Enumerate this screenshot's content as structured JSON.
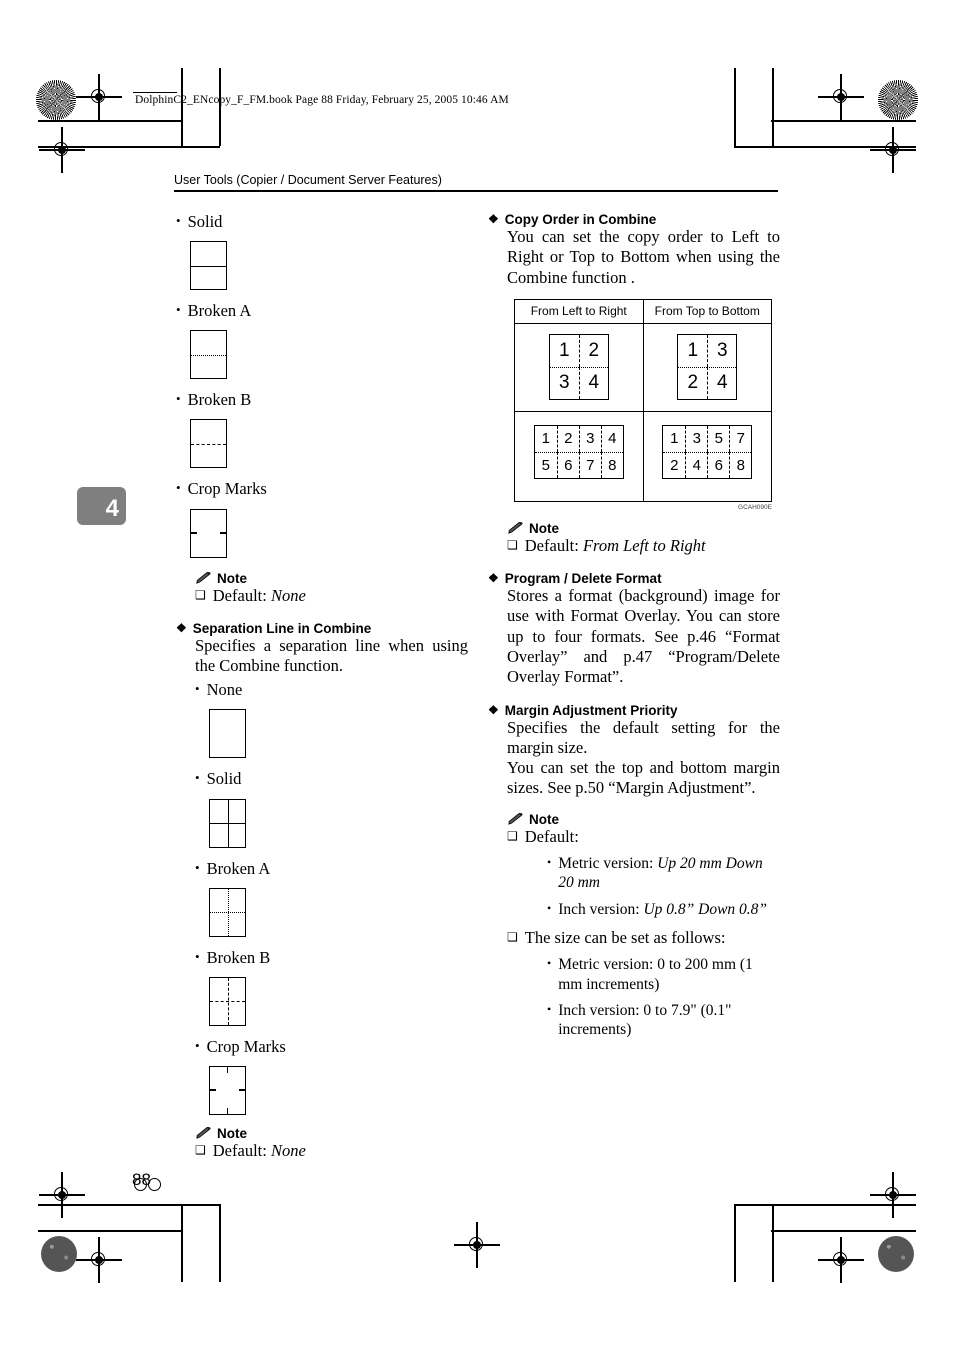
{
  "file_stamp": "DolphinC2_ENcopy_F_FM.book  Page 88  Friday, February 25, 2005  10:46 AM",
  "running_head": "User Tools (Copier / Document Server Features)",
  "chapter_tab": "4",
  "page_number": "88",
  "icons": {
    "diamond": "❖",
    "bullet": "•",
    "note_square": "❑",
    "pencil": "pencil-icon"
  },
  "left_column": {
    "top_options": [
      {
        "label": "Solid",
        "box": "solid-h"
      },
      {
        "label": "Broken A",
        "box": "dotted-h"
      },
      {
        "label": "Broken B",
        "box": "dashed-h"
      },
      {
        "label": "Crop Marks",
        "box": "crop-lr"
      }
    ],
    "note_1": {
      "title": "Note",
      "items": [
        {
          "prefix": "Default: ",
          "value": "None"
        }
      ]
    },
    "separation": {
      "heading": "Separation Line in Combine",
      "body": "Specifies a separation line when using the Combine function.",
      "options": [
        {
          "label": "None",
          "box": "none"
        },
        {
          "label": "Solid",
          "box": "solid-cross"
        },
        {
          "label": "Broken A",
          "box": "dotted-cross"
        },
        {
          "label": "Broken B",
          "box": "dashed-cross"
        },
        {
          "label": "Crop Marks",
          "box": "crop-all"
        }
      ]
    },
    "note_2": {
      "title": "Note",
      "items": [
        {
          "prefix": "Default: ",
          "value": "None"
        }
      ]
    }
  },
  "right_column": {
    "copy_order": {
      "heading": "Copy Order in Combine",
      "body": "You can set the copy order to Left to Right or Top to Bottom when using the Combine function ."
    },
    "figure": {
      "caption_code": "GCAH090E",
      "headers": [
        "From Left to Right",
        "From Top to Bottom"
      ],
      "cells": [
        {
          "layout": "2x2",
          "values": [
            "1",
            "2",
            "3",
            "4"
          ]
        },
        {
          "layout": "2x2",
          "values": [
            "1",
            "3",
            "2",
            "4"
          ]
        },
        {
          "layout": "4x2",
          "values": [
            "1",
            "2",
            "3",
            "4",
            "5",
            "6",
            "7",
            "8"
          ]
        },
        {
          "layout": "4x2",
          "values": [
            "1",
            "3",
            "5",
            "7",
            "2",
            "4",
            "6",
            "8"
          ]
        }
      ]
    },
    "note_1": {
      "title": "Note",
      "items": [
        {
          "prefix": "Default: ",
          "value": "From Left to Right"
        }
      ]
    },
    "program_delete": {
      "heading": "Program / Delete Format",
      "body": "Stores a format (background) image for use with Format Overlay. You can store up to four formats. See p.46 “Format Overlay” and p.47 “Program/Delete Overlay Format”."
    },
    "margin_priority": {
      "heading": "Margin Adjustment Priority",
      "body_1": "Specifies the default setting for the margin size.",
      "body_2": "You can set the top and bottom margin sizes. See p.50 “Margin Adjustment”."
    },
    "note_2": {
      "title": "Note",
      "default_label": "Default:",
      "default_subs": [
        {
          "prefix": "Metric version: ",
          "value": "Up 20 mm Down 20 mm"
        },
        {
          "prefix": "Inch version: ",
          "value": "Up 0.8” Down 0.8”"
        }
      ],
      "size_label": "The size can be set as follows:",
      "size_subs": [
        {
          "prefix": "",
          "value": "Metric version: 0 to 200 mm (1 mm increments)"
        },
        {
          "prefix": "",
          "value": "Inch version: 0 to 7.9\" (0.1\" increments)"
        }
      ]
    }
  }
}
